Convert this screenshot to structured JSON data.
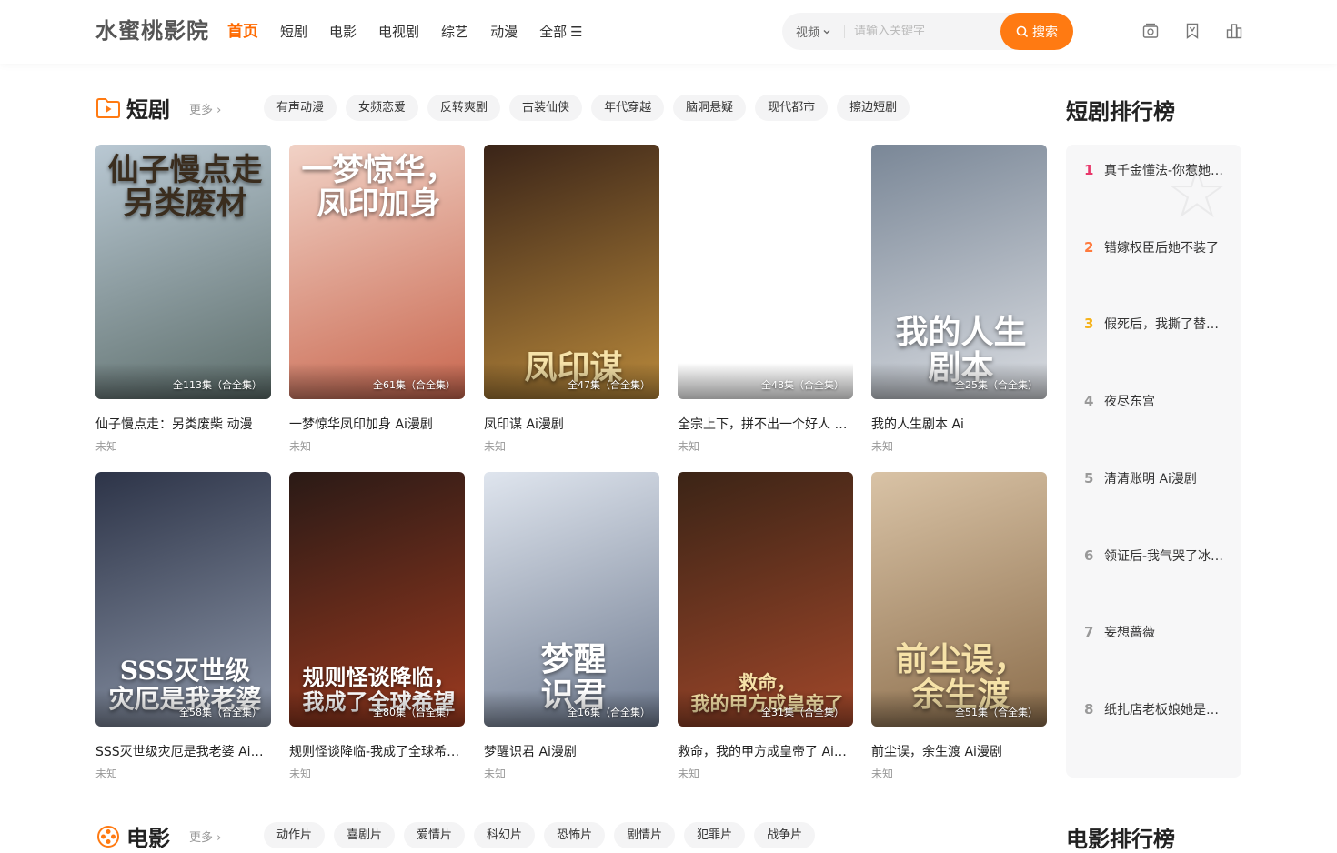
{
  "header": {
    "logo": "水蜜桃影院",
    "nav": [
      {
        "label": "首页",
        "active": true
      },
      {
        "label": "短剧"
      },
      {
        "label": "电影"
      },
      {
        "label": "电视剧"
      },
      {
        "label": "综艺"
      },
      {
        "label": "动漫"
      },
      {
        "label": "全部"
      }
    ],
    "search": {
      "type": "视频",
      "placeholder": "请输入关键字",
      "button": "搜索"
    },
    "icons": [
      "history-icon",
      "bookmark-icon",
      "ranking-icon"
    ]
  },
  "short_drama": {
    "title": "短剧",
    "more": "更多",
    "tags": [
      "有声动漫",
      "女频恋爱",
      "反转爽剧",
      "古装仙侠",
      "年代穿越",
      "脑洞悬疑",
      "现代都市",
      "擦边短剧"
    ],
    "cards": [
      {
        "title": "仙子慢点走：另类废柴 动漫",
        "sub": "未知",
        "ep": "全113集（合全集）",
        "poster_text": "仙子慢点走\n另类废材",
        "colors": [
          "#b9c8d3",
          "#5d6e6b"
        ]
      },
      {
        "title": "一梦惊华凤印加身 Ai漫剧",
        "sub": "未知",
        "ep": "全61集（合全集）",
        "poster_text": "一梦惊华，\n凤印加身",
        "colors": [
          "#f1d2c6",
          "#c9674f"
        ]
      },
      {
        "title": "凤印谋 Ai漫剧",
        "sub": "未知",
        "ep": "全47集（合全集）",
        "poster_text": "凤印谋",
        "colors": [
          "#3a2418",
          "#b9893b"
        ]
      },
      {
        "title": "全宗上下，拼不出一个好人 Ai漫剧",
        "sub": "未知",
        "ep": "全48集（合全集）",
        "poster_text": "",
        "colors": [
          "#ffffff",
          "#ffffff"
        ]
      },
      {
        "title": "我的人生剧本 Ai",
        "sub": "未知",
        "ep": "全25集（合全集）",
        "poster_text": "我的人生\n剧本",
        "colors": [
          "#7a8797",
          "#d9dce1"
        ]
      },
      {
        "title": "SSS灭世级灾厄是我老婆 Ai漫剧",
        "sub": "未知",
        "ep": "全58集（合全集）",
        "poster_text": "SSS灭世级\n灾厄是我老婆",
        "colors": [
          "#2d3448",
          "#8c96a8"
        ]
      },
      {
        "title": "规则怪谈降临-我成了全球希望 Ai漫剧",
        "sub": "未知",
        "ep": "全80集（合全集）",
        "poster_text": "规则怪谈降临，\n我成了全球希望",
        "colors": [
          "#2a1a16",
          "#9c3a1f"
        ]
      },
      {
        "title": "梦醒识君 Ai漫剧",
        "sub": "未知",
        "ep": "全16集（合全集）",
        "poster_text": "梦醒\n识君",
        "colors": [
          "#dfe5ee",
          "#6f7b90"
        ]
      },
      {
        "title": "救命，我的甲方成皇帝了 Ai漫剧",
        "sub": "未知",
        "ep": "全31集（合全集）",
        "poster_text": "救命，\n我的甲方成皇帝了",
        "colors": [
          "#3b2416",
          "#a1472a"
        ]
      },
      {
        "title": "前尘误，余生渡 Ai漫剧",
        "sub": "未知",
        "ep": "全51集（合全集）",
        "poster_text": "前尘误，\n余生渡",
        "colors": [
          "#d9c3a6",
          "#8b6d4b"
        ]
      }
    ]
  },
  "short_rank": {
    "title": "短剧排行榜",
    "items": [
      {
        "n": "1",
        "label": "真千金懂法-你惹她…",
        "color": "#e8386b"
      },
      {
        "n": "2",
        "label": "错嫁权臣后她不装了",
        "color": "#ff7a3d"
      },
      {
        "n": "3",
        "label": "假死后，我撕了替…",
        "color": "#f5b21a"
      },
      {
        "n": "4",
        "label": "夜尽东宫",
        "color": "#999999"
      },
      {
        "n": "5",
        "label": "清清账明 Ai漫剧",
        "color": "#999999"
      },
      {
        "n": "6",
        "label": "领证后-我气哭了冰…",
        "color": "#999999"
      },
      {
        "n": "7",
        "label": "妄想蔷薇",
        "color": "#999999"
      },
      {
        "n": "8",
        "label": "纸扎店老板娘她是…",
        "color": "#999999"
      }
    ]
  },
  "movies": {
    "title": "电影",
    "more": "更多",
    "tags": [
      "动作片",
      "喜剧片",
      "爱情片",
      "科幻片",
      "恐怖片",
      "剧情片",
      "犯罪片",
      "战争片"
    ],
    "rank_title": "电影排行榜"
  },
  "colors": {
    "accent": "#ff7a12",
    "active_nav": "#ff6a00"
  }
}
